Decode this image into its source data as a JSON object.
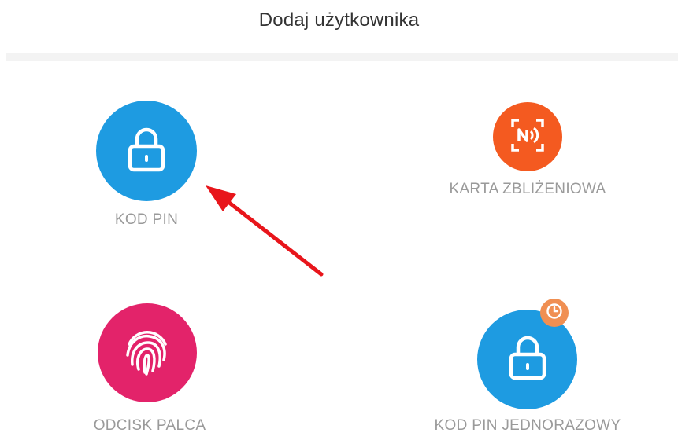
{
  "header": {
    "title": "Dodaj użytkownika"
  },
  "options": [
    {
      "label": "KOD PIN",
      "icon": "lock-icon",
      "color": "#1E9BE1"
    },
    {
      "label": "KARTA ZBLIŻENIOWA",
      "icon": "nfc-card-icon",
      "color": "#F45A20"
    },
    {
      "label": "ODCISK PALCA",
      "icon": "fingerprint-icon",
      "color": "#E3236A"
    },
    {
      "label": "KOD PIN JEDNORAZOWY",
      "icon": "lock-icon",
      "color": "#1E9BE1",
      "badge_icon": "clock-icon",
      "badge_color": "#F08F52"
    }
  ],
  "annotation": {
    "arrow_color": "#E8151B",
    "points_to": "KOD PIN"
  }
}
